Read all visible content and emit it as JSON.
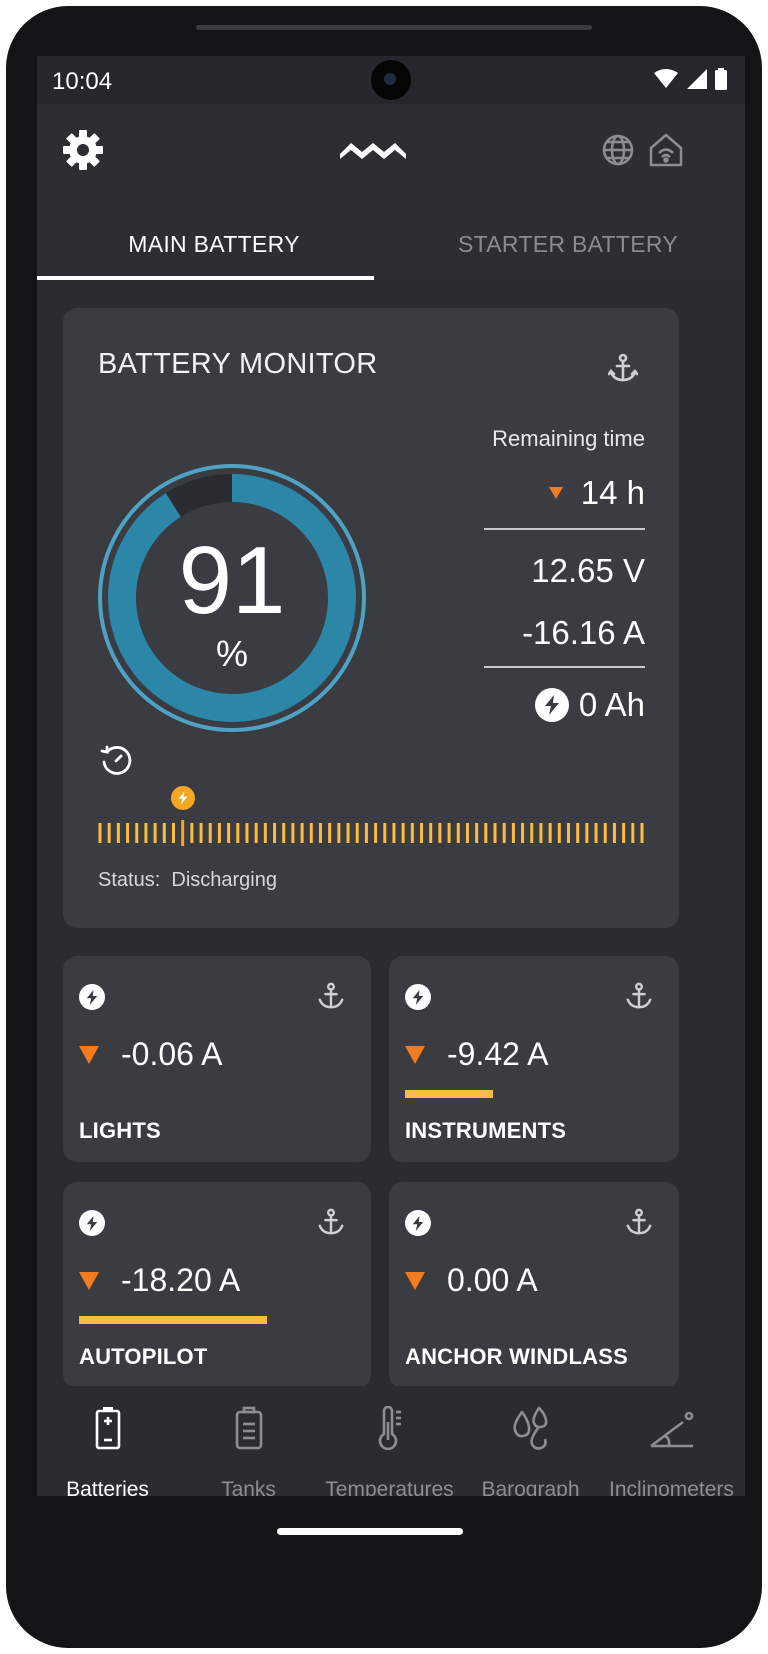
{
  "status_bar": {
    "time": "10:04"
  },
  "tabs": [
    {
      "label": "MAIN BATTERY",
      "active": true
    },
    {
      "label": "STARTER BATTERY",
      "active": false
    }
  ],
  "monitor": {
    "title": "BATTERY MONITOR",
    "soc_value": "91",
    "soc_unit": "%",
    "soc_percent": 91,
    "remaining_label": "Remaining time",
    "remaining_value": "14 h",
    "voltage": "12.65 V",
    "current": "-16.16 A",
    "amp_hours": "0 Ah",
    "status_label": "Status:",
    "status_value": "Discharging",
    "timeline_marker_fraction": 0.15
  },
  "loads": [
    {
      "name": "LIGHTS",
      "value": "-0.06 A",
      "bar_fraction": 0
    },
    {
      "name": "INSTRUMENTS",
      "value": "-9.42 A",
      "bar_fraction": 0.47
    },
    {
      "name": "AUTOPILOT",
      "value": "-18.20 A",
      "bar_fraction": 1.0
    },
    {
      "name": "ANCHOR WINDLASS",
      "value": "0.00 A",
      "bar_fraction": 0
    }
  ],
  "bottom_nav": [
    {
      "label": "Batteries",
      "icon": "battery-icon",
      "active": true
    },
    {
      "label": "Tanks",
      "icon": "tank-icon",
      "active": false
    },
    {
      "label": "Temperatures",
      "icon": "thermometer-icon",
      "active": false
    },
    {
      "label": "Barograph",
      "icon": "droplets-icon",
      "active": false
    },
    {
      "label": "Inclinometers",
      "icon": "angle-icon",
      "active": false
    }
  ],
  "colors": {
    "accent_orange": "#f47b20",
    "bar_yellow": "#f8bd40",
    "gauge_blue": "#2b86a8",
    "gauge_ring": "#4ea3c4"
  }
}
